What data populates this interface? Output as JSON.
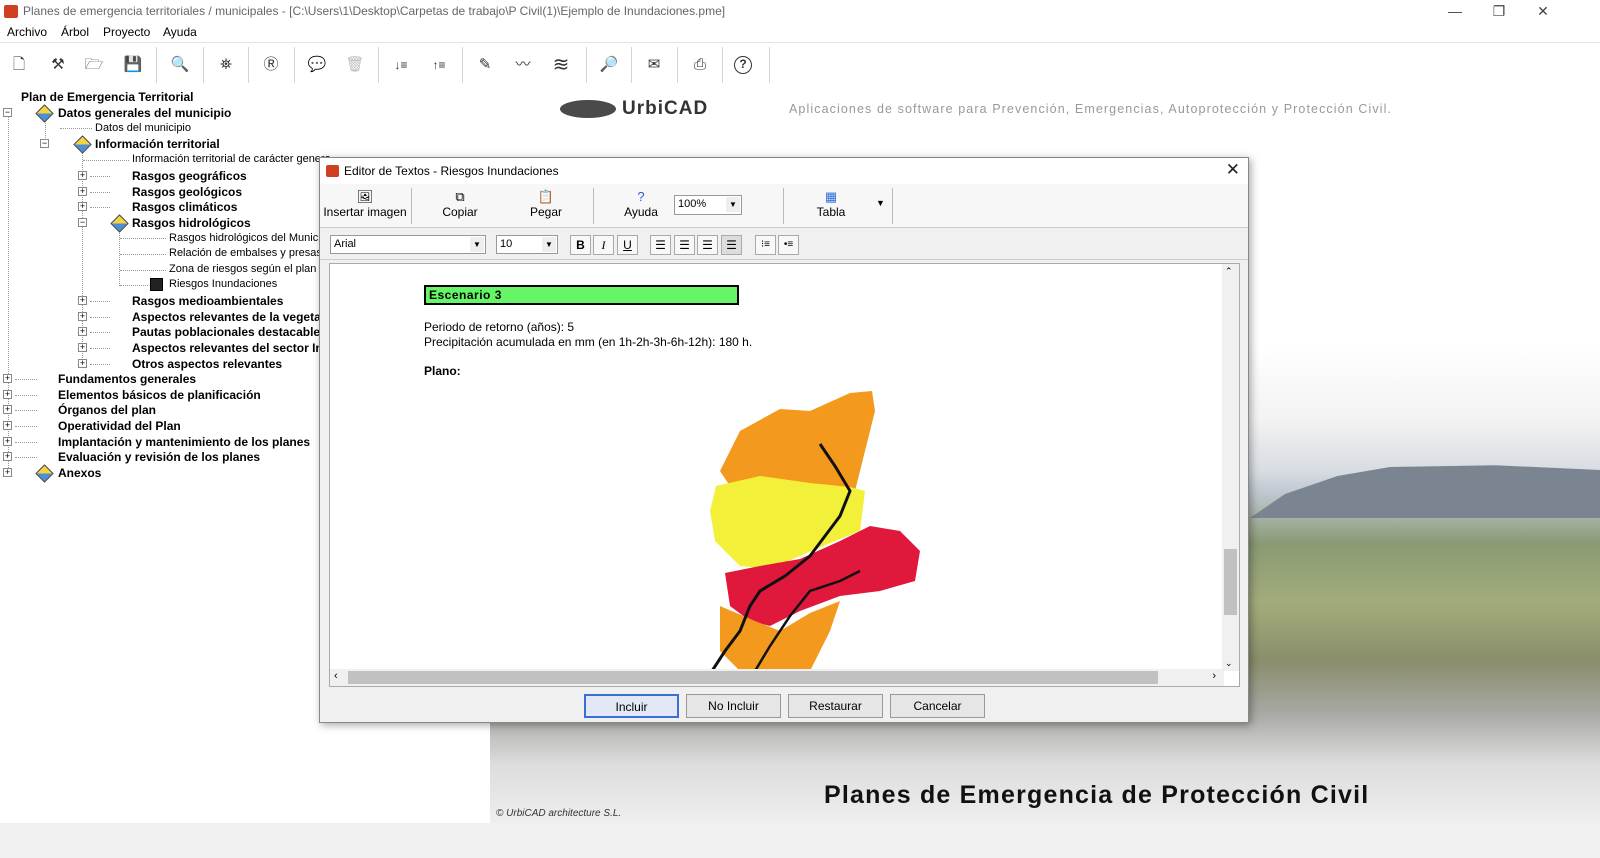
{
  "app": {
    "title": "Planes de emergencia territoriales / municipales - [C:\\Users\\1\\Desktop\\Carpetas de trabajo\\P Civil(1)\\Ejemplo de Inundaciones.pme]",
    "window_controls": {
      "minimize": "—",
      "restore": "❐",
      "close": "✕"
    }
  },
  "menu": [
    "Archivo",
    "Árbol",
    "Proyecto",
    "Ayuda"
  ],
  "toolbar": {
    "icons": [
      "new-file-icon",
      "wand-icon",
      "open-folder-icon",
      "save-icon",
      "preview-icon",
      "binoculars-icon",
      "report-icon",
      "comment-icon",
      "trash-icon",
      "sort-down-icon",
      "sort-up-icon",
      "pencil-icon",
      "seismic-icon",
      "wave-icon",
      "search-doc-icon",
      "envelope-icon",
      "pdf-icon",
      "help-icon"
    ],
    "glyphs": [
      "🗋",
      "⚒",
      "🗁",
      "💾",
      "🔍",
      "⛯",
      "Ⓡ",
      "💬",
      "🗑",
      "↓≡",
      "↑≡",
      "✎",
      "〰",
      "≋",
      "🔎",
      "✉",
      "⎙",
      "?"
    ]
  },
  "tree": {
    "root": "Plan de Emergencia Territorial",
    "items": [
      "Datos generales del municipio",
      "Datos del municipio",
      "Información territorial",
      "Información territorial de carácter general",
      "Rasgos geográficos",
      "Rasgos geológicos",
      "Rasgos climáticos",
      "Rasgos hidrológicos",
      "Rasgos hidrológicos del Municipio",
      "Relación de embalses y presas",
      "Zona de riesgos según el plan de",
      "Riesgos Inundaciones",
      "Rasgos medioambientales",
      "Aspectos relevantes de la vegetación",
      "Pautas poblacionales destacables",
      "Aspectos relevantes del sector In",
      "Otros aspectos relevantes",
      "Fundamentos generales",
      "Elementos básicos de planificación",
      "Órganos del plan",
      "Operatividad del Plan",
      "Implantación y mantenimiento de los planes",
      "Evaluación y revisión de los planes",
      "Anexos"
    ],
    "expanders": {
      "minus": "−",
      "plus": "+"
    }
  },
  "banner": {
    "logo": "UrbiCAD",
    "tagline": "Aplicaciones de software para Prevención, Emergencias, Autoprotección y Protección Civil.",
    "title": "Planes de Emergencia de Protección Civil",
    "copyright": "© UrbiCAD architecture S.L."
  },
  "dialog": {
    "title": "Editor de Textos - Riesgos Inundaciones",
    "close": "✕",
    "buttons": {
      "insert_image": "Insertar imagen",
      "copy": "Copiar",
      "paste": "Pegar",
      "help": "Ayuda",
      "table": "Tabla"
    },
    "zoom": "100%",
    "font": "Arial",
    "size": "10",
    "format": {
      "bold": "B",
      "italic": "I",
      "underline": "U"
    },
    "content": {
      "scenario": "Escenario 3",
      "return_period": "Periodo de retorno (años): 5",
      "precipitation": "Precipitación acumulada en mm (en 1h-2h-3h-6h-12h): 180 h.",
      "plan_label": "Plano:"
    },
    "actions": {
      "include": "Incluir",
      "exclude": "No Incluir",
      "restore": "Restaurar",
      "cancel": "Cancelar"
    }
  },
  "colors": {
    "scenario_fill": "#66f566",
    "map_orange": "#f39a1e",
    "map_yellow": "#f3f03a",
    "map_red": "#e0183c",
    "accent_default_button": "#3a6fd8"
  }
}
